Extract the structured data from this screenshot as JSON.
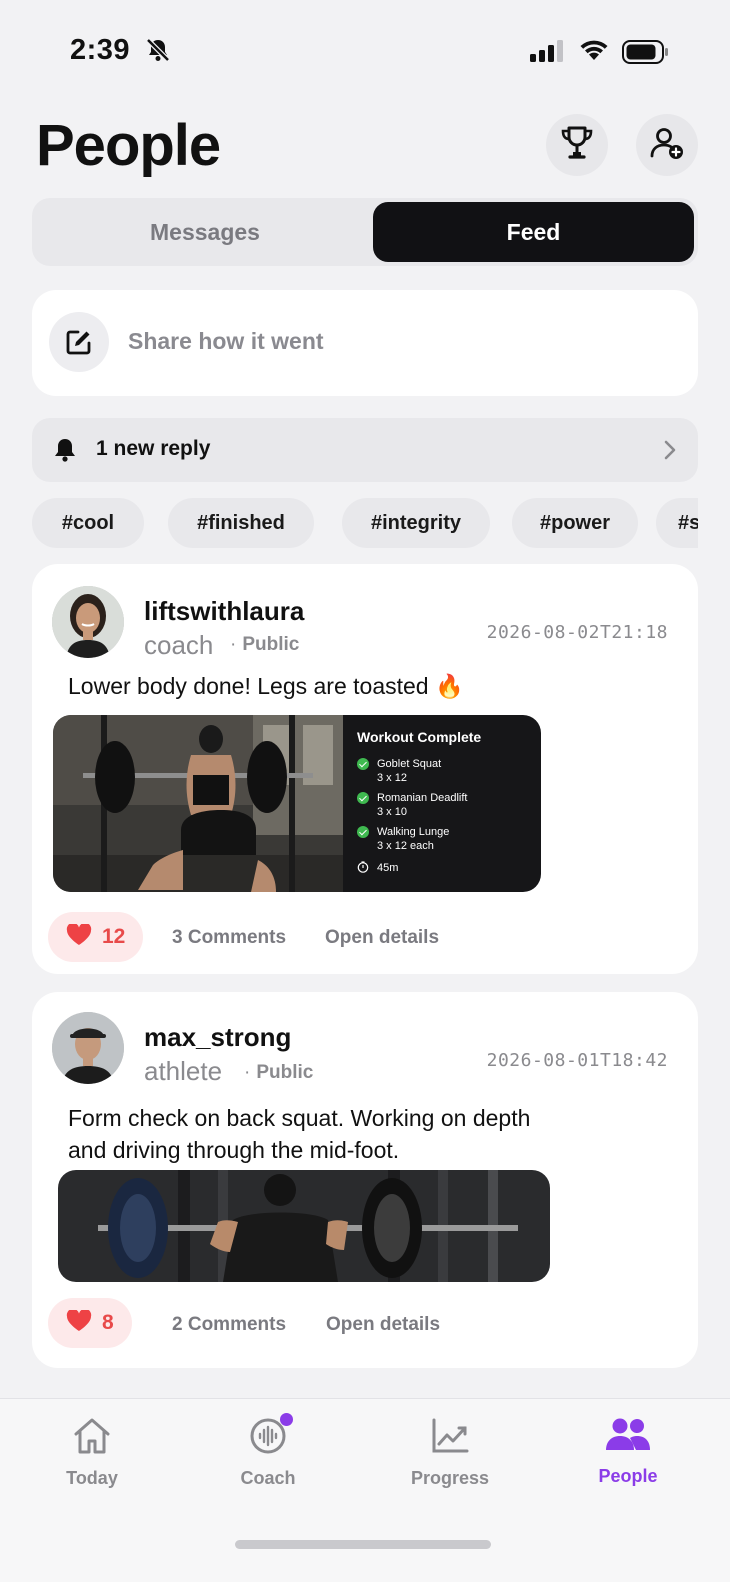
{
  "status_bar": {
    "time": "2:39"
  },
  "header": {
    "title": "People"
  },
  "segments": {
    "messages": "Messages",
    "feed": "Feed"
  },
  "share": {
    "placeholder": "Share how it went"
  },
  "reply_banner": {
    "text": "1 new reply"
  },
  "tags": [
    "#cool",
    "#finished",
    "#integrity",
    "#power",
    "#s"
  ],
  "posts": [
    {
      "username": "liftswithlaura",
      "role": "coach",
      "visibility": "Public",
      "timestamp": "2026-08-02T21:18",
      "text": "Lower body done! Legs are toasted 🔥",
      "workout": {
        "title": "Workout Complete",
        "items": [
          {
            "name": "Goblet Squat",
            "sets": "3 x 12"
          },
          {
            "name": "Romanian Deadlift",
            "sets": "3 x 10"
          },
          {
            "name": "Walking Lunge",
            "sets": "3 x 12 each"
          }
        ],
        "duration": "45m"
      },
      "likes": "12",
      "comments": "3 Comments",
      "details": "Open details"
    },
    {
      "username": "max_strong",
      "role": "athlete",
      "visibility": "Public",
      "timestamp": "2026-08-01T18:42",
      "text_line1": "Form check on back squat. Working on depth",
      "text_line2": "and driving through the mid-foot.",
      "likes": "8",
      "comments": "2 Comments",
      "details": "Open details"
    }
  ],
  "tabbar": {
    "today": "Today",
    "coach": "Coach",
    "progress": "Progress",
    "people": "People",
    "active": "People",
    "accent_color": "#8b3ce8"
  }
}
